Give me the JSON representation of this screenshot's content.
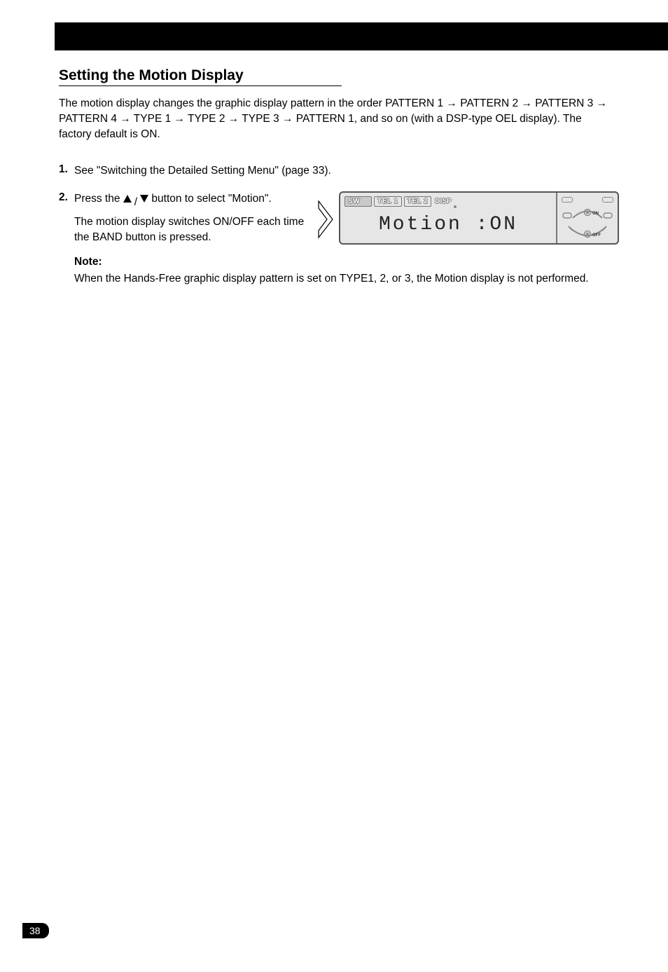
{
  "section": {
    "title": "Setting the Motion Display",
    "intro": "The motion display changes the graphic display pattern in the order PATTERN 1 → PATTERN 2 → PATTERN 3 → PATTERN 4 → TYPE 1 → TYPE 2 → TYPE 3 → PATTERN 1, and so on (with a DSP-type OEL display). The factory default is ON."
  },
  "steps": {
    "s1": {
      "num": "1.",
      "text_a": "See \"Switching the Detailed Setting Menu\" ",
      "page_ref": "(page 33)",
      "text_b": "."
    },
    "s2": {
      "num": "2.",
      "line1_a": "Press the ",
      "line1_b": "/",
      "line1_c": " button to select \"Motion\".",
      "line2": "The motion display switches ON/OFF each time the BAND button is pressed.",
      "note_label": "Note:",
      "note_text": "When the Hands-Free graphic display pattern is set on TYPE1, 2, or 3, the Motion display is not performed."
    }
  },
  "lcd": {
    "tabs": {
      "sw": "SW",
      "tel1": "TEL 1",
      "tel2": "TEL 2",
      "disp": "DISP"
    },
    "text": "Motion  :ON",
    "labels": {
      "on": "ON",
      "off": "OFF"
    }
  },
  "page_number": "38"
}
